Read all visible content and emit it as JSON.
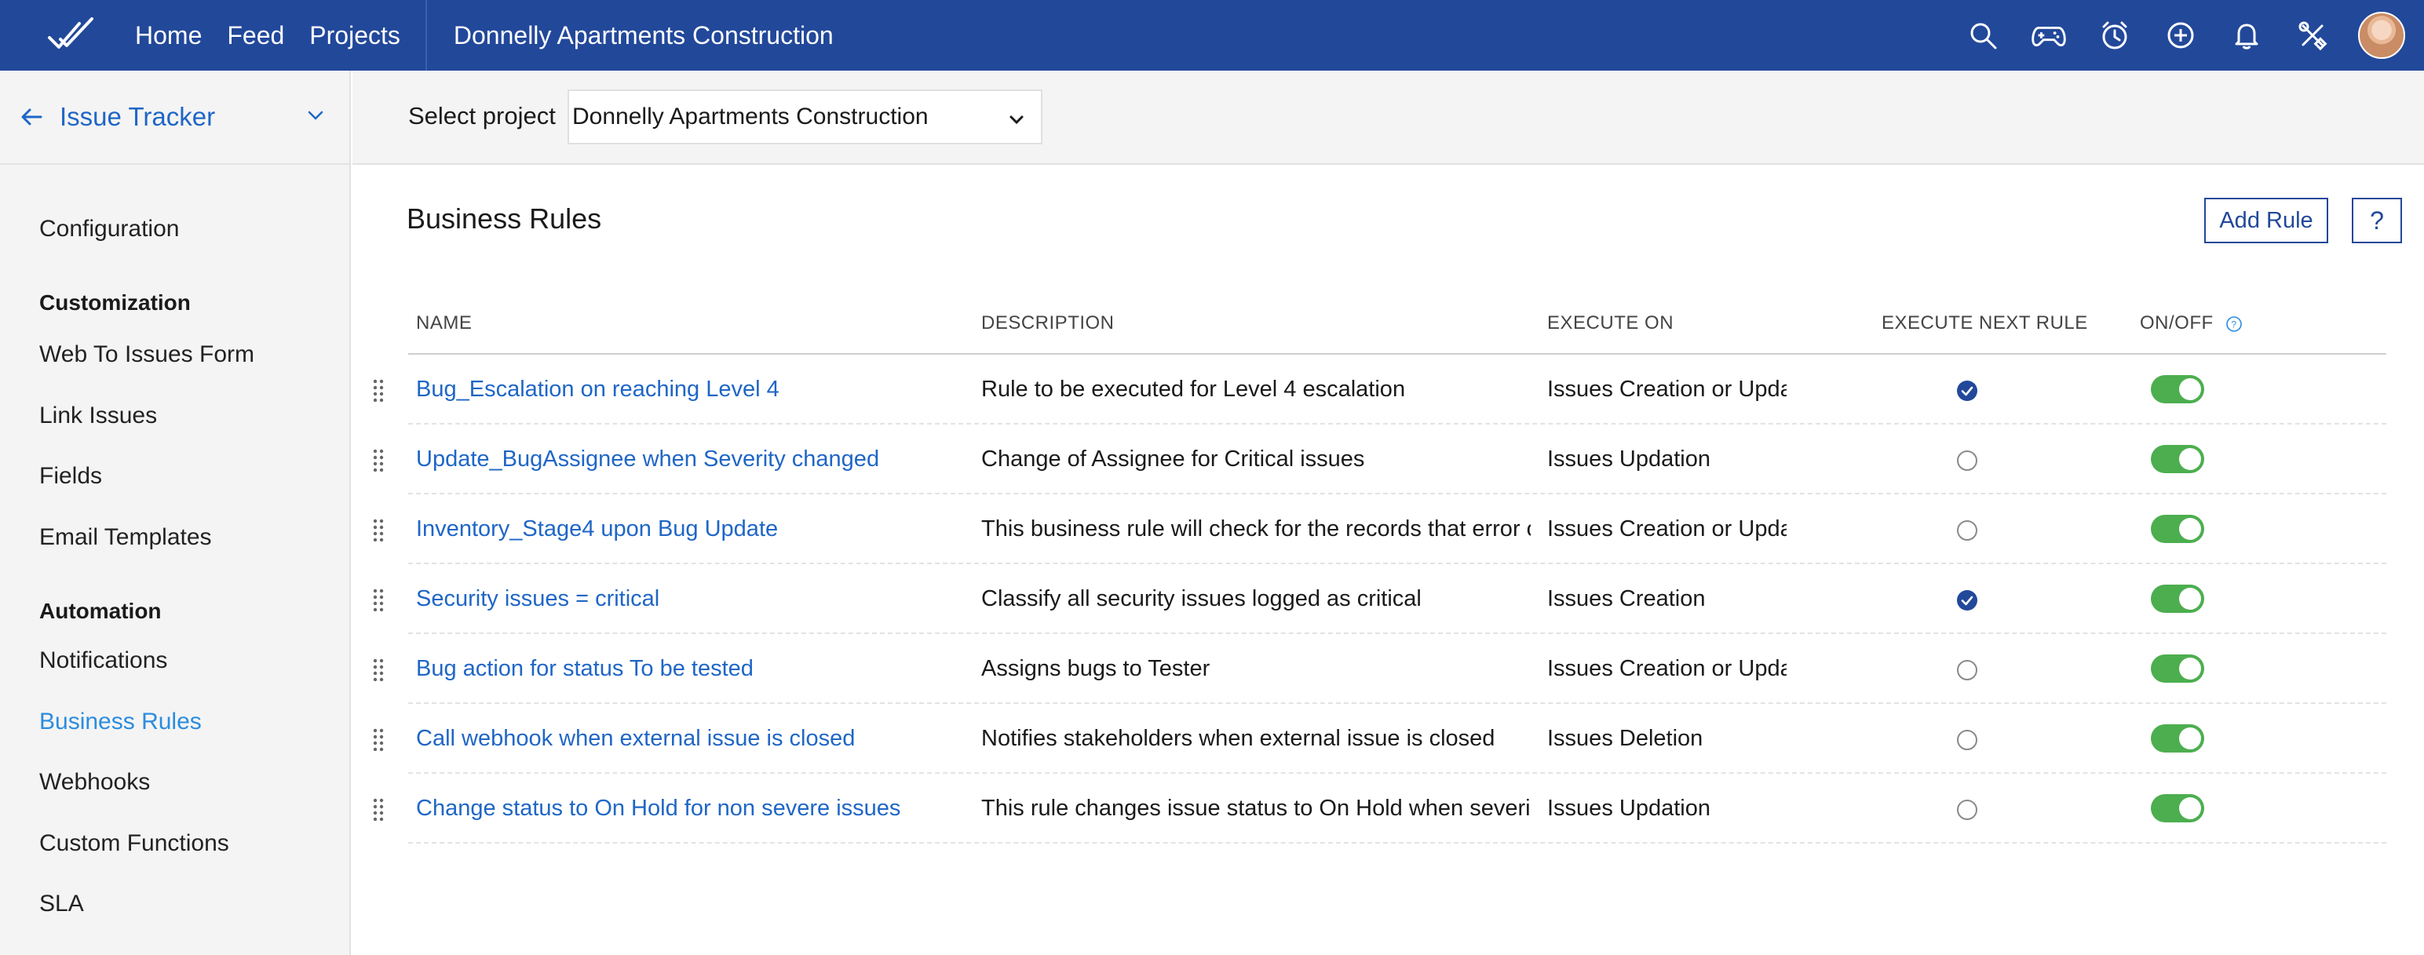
{
  "topbar": {
    "nav": [
      "Home",
      "Feed",
      "Projects"
    ],
    "project_title": "Donnelly Apartments Construction",
    "icons": [
      "search-icon",
      "gamepad-icon",
      "timer-icon",
      "add-circle-icon",
      "bell-icon",
      "tools-icon"
    ],
    "color": "#22489a"
  },
  "sidebar": {
    "title": "Issue Tracker",
    "configuration": "Configuration",
    "customization_label": "Customization",
    "customization_items": [
      "Web To Issues Form",
      "Link Issues",
      "Fields",
      "Email Templates"
    ],
    "automation_label": "Automation",
    "automation_items": [
      "Notifications",
      "Business Rules",
      "Webhooks",
      "Custom Functions",
      "SLA"
    ],
    "active_item": "Business Rules"
  },
  "project_select": {
    "label": "Select project",
    "value": "Donnelly Apartments Construction"
  },
  "main": {
    "title": "Business Rules",
    "add_rule_label": "Add Rule",
    "help_label": "?"
  },
  "table": {
    "headers": {
      "name": "NAME",
      "description": "DESCRIPTION",
      "execute_on": "EXECUTE ON",
      "execute_next": "EXECUTE NEXT RULE",
      "on_off": "ON/OFF"
    },
    "rows": [
      {
        "name": "Bug_Escalation on reaching Level 4",
        "description": "Rule to be executed for Level 4 escalation",
        "execute_on": "Issues Creation or Updation",
        "execute_next": true,
        "enabled": true
      },
      {
        "name": "Update_BugAssignee when Severity changed",
        "description": "Change of Assignee for Critical issues",
        "execute_on": "Issues Updation",
        "execute_next": false,
        "enabled": true
      },
      {
        "name": "Inventory_Stage4 upon Bug Update",
        "description": "This business rule will check for the records that error out",
        "execute_on": "Issues Creation or Updation",
        "execute_next": false,
        "enabled": true
      },
      {
        "name": "Security issues = critical",
        "description": "Classify all security issues logged as critical",
        "execute_on": "Issues Creation",
        "execute_next": true,
        "enabled": true
      },
      {
        "name": "Bug action for status To be tested",
        "description": "Assigns bugs to Tester",
        "execute_on": "Issues Creation or Updation",
        "execute_next": false,
        "enabled": true
      },
      {
        "name": "Call webhook when external issue is closed",
        "description": "Notifies stakeholders when external issue is closed",
        "execute_on": "Issues Deletion",
        "execute_next": false,
        "enabled": true
      },
      {
        "name": "Change status to On Hold for non severe issues",
        "description": "This rule changes issue status to On Hold when severity is low",
        "execute_on": "Issues Updation",
        "execute_next": false,
        "enabled": true
      }
    ]
  }
}
